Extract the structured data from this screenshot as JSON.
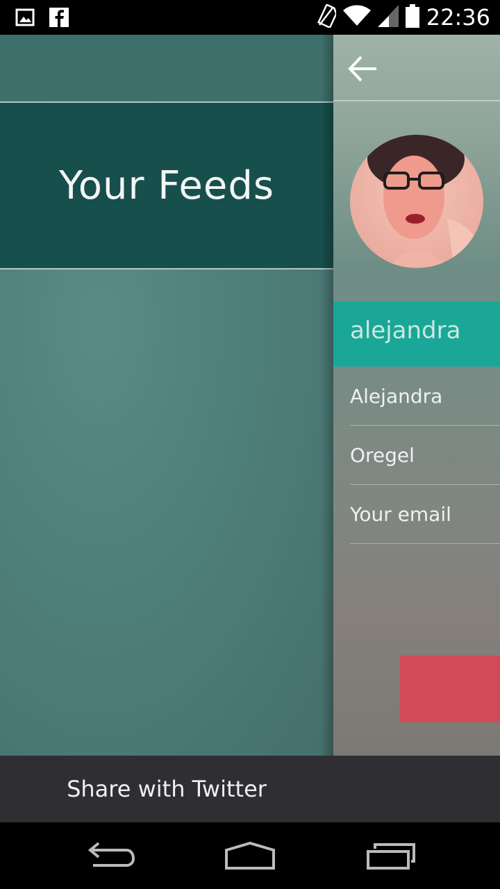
{
  "status_bar": {
    "time": "22:36",
    "icons": [
      "gallery-icon",
      "facebook-icon",
      "no-sim-icon",
      "wifi-icon",
      "signal-icon",
      "battery-icon"
    ]
  },
  "left_panel": {
    "title": "Your Feeds",
    "share_label": "Share with Twitter"
  },
  "right_panel": {
    "back_icon": "arrow-left-icon",
    "username": "alejandra",
    "fields": {
      "first_name": "Alejandra",
      "last_name": "Oregel",
      "email_placeholder": "Your email"
    }
  },
  "nav_bar": {
    "icons": [
      "back-nav-icon",
      "home-nav-icon",
      "recents-nav-icon"
    ]
  },
  "colors": {
    "teal_dark": "#174f4c",
    "teal_panel": "#4f7f7b",
    "accent_teal": "#1aa797",
    "red_button": "#d14a57",
    "bottom_bar": "#2e2e33"
  }
}
